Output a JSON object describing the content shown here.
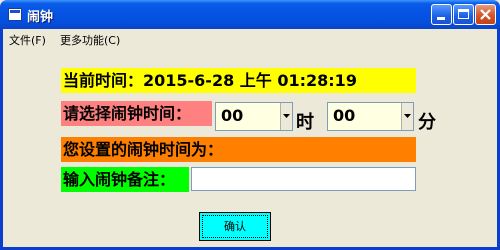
{
  "window": {
    "title": "闹钟"
  },
  "menu": {
    "items": [
      {
        "label": "文件(F)"
      },
      {
        "label": "更多功能(C)"
      }
    ]
  },
  "clock": {
    "label": "当前时间：2015-6-28 上午 01:28:19",
    "color": "#ffff00"
  },
  "alarm": {
    "label": "请选择闹钟时间：",
    "label_color": "#ff8080",
    "hour_value": "00",
    "hour_unit": "时",
    "minute_value": "00",
    "minute_unit": "分",
    "input_bg": "#ffffe1"
  },
  "status": {
    "label": "您设置的闹钟时间为：",
    "color": "#ff8000"
  },
  "note": {
    "label": "输入闹钟备注：",
    "color": "#00ff00",
    "value": ""
  },
  "confirm": {
    "label": "确认",
    "color": "#00ffff"
  }
}
